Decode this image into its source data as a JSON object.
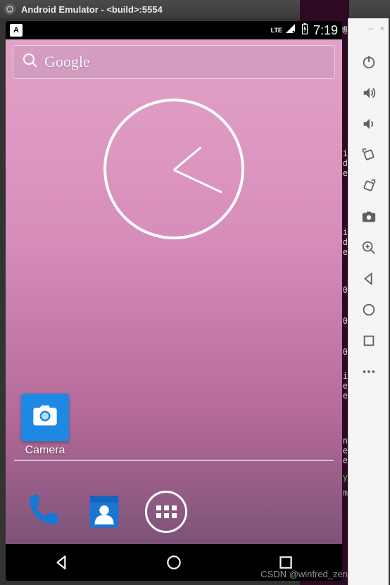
{
  "window": {
    "title": "Android Emulator - <build>:5554"
  },
  "statusbar": {
    "badge_letter": "A",
    "network": "LTE",
    "time": "7:19"
  },
  "search": {
    "placeholder": "Google"
  },
  "clock": {
    "hour_angle": -40,
    "minute_angle": 25
  },
  "apps": {
    "camera_label": "Camera"
  },
  "dock": {
    "phone": "Phone",
    "contacts": "Contacts",
    "all_apps": "All apps"
  },
  "toolbar": {
    "minimize": "–",
    "close": "×",
    "power": "Power",
    "vol_up": "Volume Up",
    "vol_down": "Volume Down",
    "rotate_left": "Rotate Left",
    "rotate_right": "Rotate Right",
    "screenshot": "Screenshot",
    "zoom": "Zoom",
    "back": "Back",
    "overview": "Overview",
    "home": "Home",
    "more": "More"
  },
  "terminal": {
    "lines": [
      "_zen的博",
      "",
      "i",
      "d",
      "e",
      "",
      "i",
      "d",
      "e",
      "",
      "0",
      "",
      "0",
      "",
      "0",
      "",
      "i",
      "d at the",
      "ed succe",
      "",
      "",
      "ill usin",
      "d at the",
      "ed succe",
      "",
      "essfully"
    ],
    "gray_line": "og.csdnim"
  },
  "watermark": "CSDN @winfred_zen"
}
